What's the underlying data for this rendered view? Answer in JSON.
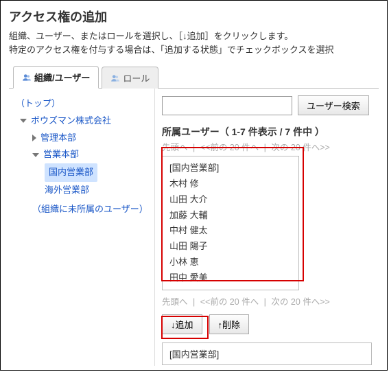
{
  "header": {
    "title": "アクセス権の追加",
    "desc_line1": "組織、ユーザー、またはロールを選択し、［↓追加］をクリックします。",
    "desc_line2": "特定のアクセス権を付与する場合は、「追加する状態」でチェックボックスを選択"
  },
  "tabs": {
    "org_user": "組織/ユーザー",
    "role": "ロール"
  },
  "tree": {
    "top": "（トップ）",
    "company": "ボウズマン株式会社",
    "admin_hq": "管理本部",
    "sales_hq": "営業本部",
    "domestic_sales": "国内営業部",
    "overseas_sales": "海外営業部",
    "unassigned": "（組織に未所属のユーザー）"
  },
  "search": {
    "placeholder": "",
    "button": "ユーザー検索"
  },
  "userlist": {
    "title": "所属ユーザー（ 1-7 件表示 / 7 件中 ）",
    "pager_top_first": "先頭へ",
    "pager_top_prev": "<<前の 20 件へ",
    "pager_top_next": "次の 20 件へ>>",
    "items": [
      "[国内営業部]",
      "木村 修",
      "山田 大介",
      "加藤 大輔",
      "中村 健太",
      "山田 陽子",
      "小林 恵",
      "田中 愛美"
    ],
    "pager_bottom_first": "先頭へ",
    "pager_bottom_prev": "<<前の 20 件へ",
    "pager_bottom_next": "次の 20 件へ>>"
  },
  "actions": {
    "add": "↓追加",
    "remove": "↑削除"
  },
  "result": {
    "selected": "[国内営業部]"
  }
}
